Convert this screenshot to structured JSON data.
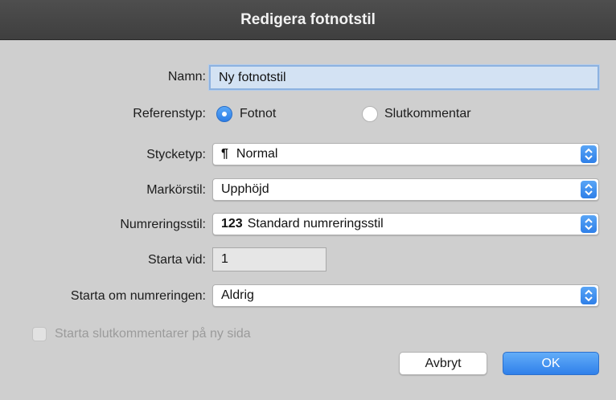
{
  "window": {
    "title": "Redigera fotnotstil"
  },
  "form": {
    "name_label": "Namn:",
    "name_value": "Ny fotnotstil",
    "reftype_label": "Referenstyp:",
    "reftype_options": [
      {
        "label": "Fotnot",
        "selected": true
      },
      {
        "label": "Slutkommentar",
        "selected": false
      }
    ],
    "paragraph_label": "Stycketyp:",
    "paragraph_icon": "¶",
    "paragraph_value": "Normal",
    "marker_label": "Markörstil:",
    "marker_value": "Upphöjd",
    "numbering_label": "Numreringsstil:",
    "numbering_icon": "123",
    "numbering_value": "Standard numreringsstil",
    "start_label": "Starta vid:",
    "start_value": "1",
    "restart_label": "Starta om numreringen:",
    "restart_value": "Aldrig",
    "checkbox_label": "Starta slutkommentarer på ny sida",
    "checkbox_checked": false,
    "checkbox_enabled": false
  },
  "buttons": {
    "cancel": "Avbryt",
    "ok": "OK"
  },
  "colors": {
    "accent": "#2f80ea",
    "titlebar": "#474747",
    "panel": "#cfcfcf"
  }
}
